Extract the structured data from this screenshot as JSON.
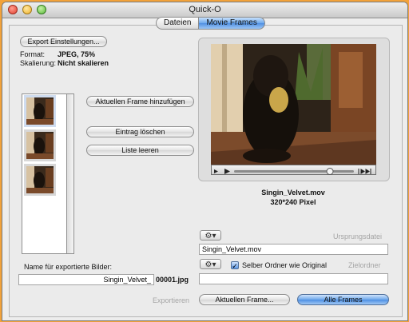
{
  "window": {
    "title": "Quick-O"
  },
  "tabs": [
    {
      "label": "Dateien"
    },
    {
      "label": "Movie Frames"
    }
  ],
  "export_settings_button": "Export Einstellungen...",
  "format": {
    "label": "Format:",
    "value": "JPEG, 75%"
  },
  "scaling": {
    "label": "Skalierung:",
    "value": "Nicht skalieren"
  },
  "buttons": {
    "add_frame": "Aktuellen Frame hinzufügen",
    "delete_entry": "Eintrag löschen",
    "clear_list": "Liste leeren",
    "export": "Exportieren",
    "current_frame": "Aktuellen Frame...",
    "all_frames": "Alle Frames"
  },
  "movie": {
    "filename": "Singin_Velvet.mov",
    "dimensions": "320*240 Pixel"
  },
  "source_folder": {
    "label": "Ursprungsdatei",
    "value": "Singin_Velvet.mov"
  },
  "target_folder": {
    "label": "Zielordner",
    "value": ""
  },
  "same_folder_checkbox": {
    "label": "Selber Ordner wie Original",
    "checked": true
  },
  "export_name": {
    "label": "Name für exportierte Bilder:",
    "value": "Singin_Velvet_",
    "suffix": "00001.jpg"
  },
  "colors": {
    "accent": "#4f8fe2",
    "background": "#f2a23a"
  }
}
